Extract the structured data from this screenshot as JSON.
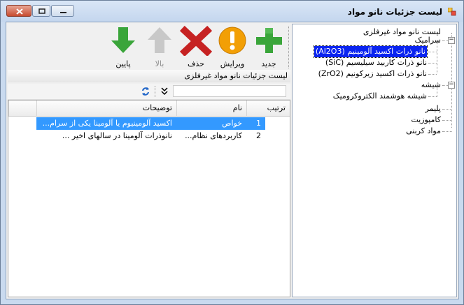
{
  "window": {
    "title": "لیست جزئیات نانو مواد"
  },
  "toolbar": {
    "new_label": "جدید",
    "edit_label": "ویرایش",
    "delete_label": "حذف",
    "up_label": "بالا",
    "down_label": "پایین"
  },
  "panel": {
    "caption": "لیست جزئیات نانو مواد غیرفلزی"
  },
  "grid": {
    "columns": [
      "ترتیب",
      "نام",
      "توضیحات"
    ],
    "rows": [
      {
        "order": "1",
        "name": "خواص",
        "desc": "اکسید آلومینیوم یا آلومینا یکی از سرام..."
      },
      {
        "order": "2",
        "name": "کاربردهای نظام...",
        "desc": "نانوذرات آلومینا در سالهای اخیر ..."
      }
    ]
  },
  "tree": {
    "root": "لیست نانو مواد غیرفلزی",
    "ceramic": "سرامیک",
    "ceramic_children": [
      "نانو ذرات اکسید آلومینیم (Al2O3)",
      "نانو ذرات کاربید سیلیسیم (SiC)",
      "نانو ذرات اکسید زیرکونیم (ZrO2)"
    ],
    "glass": "شیشه",
    "glass_children": [
      "شیشه هوشمند الکتروکرومیک"
    ],
    "others": [
      "پلیمر",
      "کامپوزیت",
      "مواد کربنی"
    ]
  },
  "colors": {
    "selection": "#0a24f0",
    "grid_selection": "#3399ff",
    "add_green": "#3aa53a",
    "delete_red": "#c62222",
    "edit_orange": "#f29f05"
  }
}
